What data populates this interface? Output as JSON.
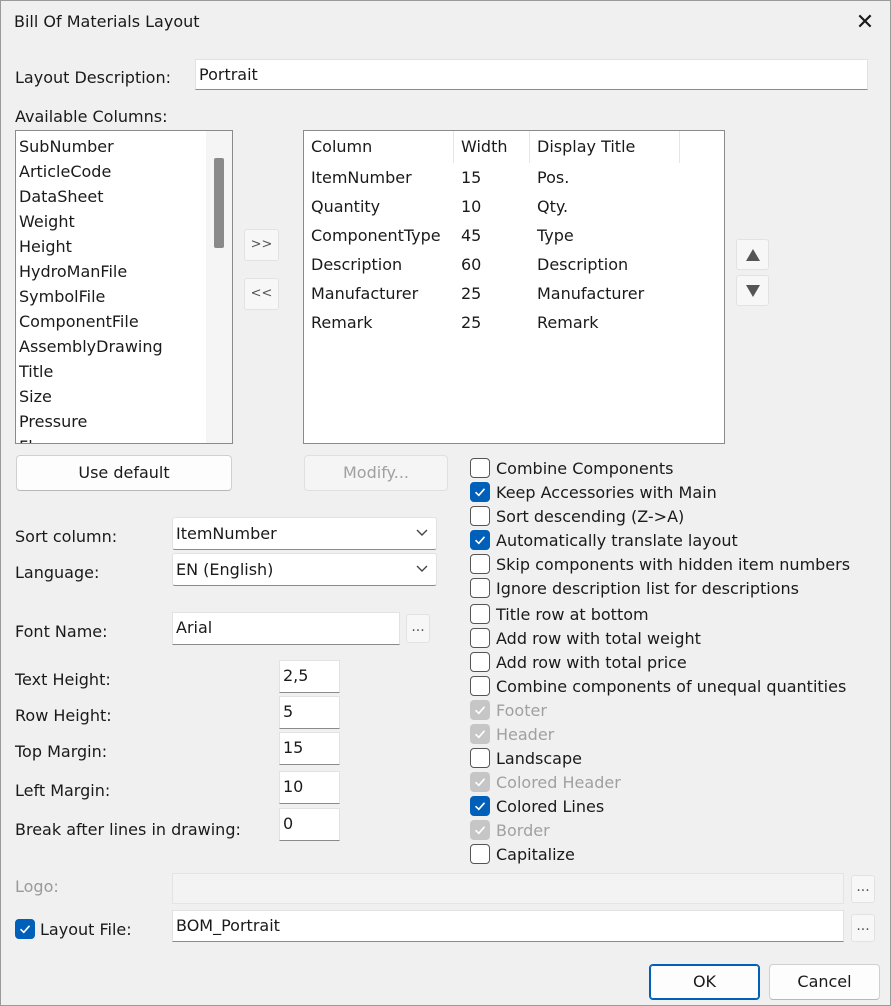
{
  "window": {
    "title": "Bill Of Materials Layout",
    "close_glyph": "✕"
  },
  "layout_description": {
    "label": "Layout Description:",
    "value": "Portrait"
  },
  "available": {
    "label": "Available Columns:",
    "items": [
      "SubNumber",
      "ArticleCode",
      "DataSheet",
      "Weight",
      "Height",
      "HydroManFile",
      "SymbolFile",
      "ComponentFile",
      "AssemblyDrawing",
      "Title",
      "Size",
      "Pressure",
      "Flow"
    ]
  },
  "move_buttons": {
    "add": ">>",
    "remove": "<<"
  },
  "selected": {
    "headers": [
      "Column",
      "Width",
      "Display Title"
    ],
    "rows": [
      [
        "ItemNumber",
        "15",
        "Pos."
      ],
      [
        "Quantity",
        "10",
        "Qty."
      ],
      [
        "ComponentType",
        "45",
        "Type"
      ],
      [
        "Description",
        "60",
        "Description"
      ],
      [
        "Manufacturer",
        "25",
        "Manufacturer"
      ],
      [
        "Remark",
        "25",
        "Remark"
      ]
    ]
  },
  "buttons": {
    "use_default": "Use default",
    "modify": "Modify...",
    "ok": "OK",
    "cancel": "Cancel",
    "browse": "..."
  },
  "sort": {
    "label": "Sort column:",
    "value": "ItemNumber"
  },
  "language": {
    "label": "Language:",
    "value": "EN (English)"
  },
  "font": {
    "label": "Font Name:",
    "value": "Arial"
  },
  "text_height": {
    "label": "Text Height:",
    "value": "2,5"
  },
  "row_height": {
    "label": "Row Height:",
    "value": "5"
  },
  "top_margin": {
    "label": "Top Margin:",
    "value": "15"
  },
  "left_margin": {
    "label": "Left Margin:",
    "value": "10"
  },
  "break_after": {
    "label": "Break after lines in drawing:",
    "value": "0"
  },
  "logo": {
    "label": "Logo:",
    "value": ""
  },
  "layout_file": {
    "label": "Layout File:",
    "value": "BOM_Portrait",
    "checked": true
  },
  "options": [
    {
      "label": "Combine Components",
      "state": "unchecked"
    },
    {
      "label": "Keep Accessories with Main",
      "state": "checked"
    },
    {
      "label": "Sort descending (Z->A)",
      "state": "unchecked"
    },
    {
      "label": "Automatically translate layout",
      "state": "checked"
    },
    {
      "label": "Skip components with hidden item numbers",
      "state": "unchecked"
    },
    {
      "label": "Ignore description list for descriptions",
      "state": "unchecked"
    },
    {
      "label": "Title row at bottom",
      "state": "unchecked"
    },
    {
      "label": "Add row with total weight",
      "state": "unchecked"
    },
    {
      "label": "Add row with total price",
      "state": "unchecked"
    },
    {
      "label": "Combine components of unequal quantities",
      "state": "unchecked"
    },
    {
      "label": "Footer",
      "state": "disabled-checked"
    },
    {
      "label": "Header",
      "state": "disabled-checked"
    },
    {
      "label": "Landscape",
      "state": "unchecked"
    },
    {
      "label": "Colored Header",
      "state": "disabled-checked"
    },
    {
      "label": "Colored Lines",
      "state": "checked"
    },
    {
      "label": "Border",
      "state": "disabled-checked"
    },
    {
      "label": "Capitalize",
      "state": "unchecked"
    }
  ],
  "colors": {
    "accent": "#005fb8",
    "disabled_check": "#c6c6c6",
    "background": "#f0f0f0"
  }
}
